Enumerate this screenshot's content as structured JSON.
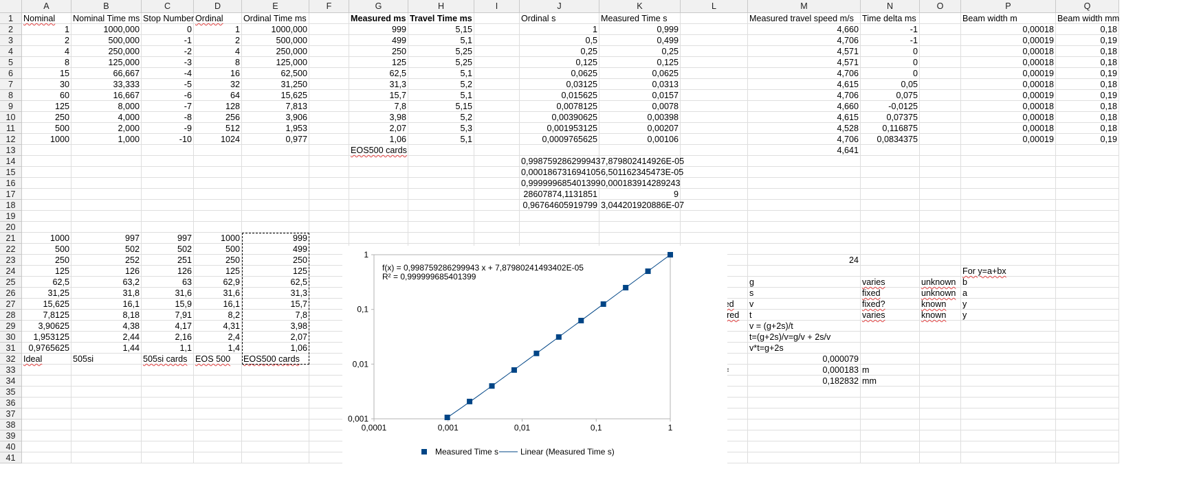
{
  "columns": [
    "A",
    "B",
    "C",
    "D",
    "E",
    "F",
    "G",
    "H",
    "I",
    "J",
    "K",
    "L",
    "M",
    "N",
    "O",
    "P",
    "Q"
  ],
  "rows": 41,
  "cells": [
    {
      "ref": "A1",
      "v": "Nominal",
      "sq": true
    },
    {
      "ref": "B1",
      "v": "Nominal Time ms"
    },
    {
      "ref": "C1",
      "v": "Stop Number"
    },
    {
      "ref": "D1",
      "v": "Ordinal",
      "sq": true
    },
    {
      "ref": "E1",
      "v": "Ordinal Time ms"
    },
    {
      "ref": "G1",
      "v": "Measured ms",
      "b": true
    },
    {
      "ref": "H1",
      "v": "Travel Time ms",
      "b": true
    },
    {
      "ref": "J1",
      "v": "Ordinal s"
    },
    {
      "ref": "K1",
      "v": "Measured Time s"
    },
    {
      "ref": "M1",
      "v": "Measured travel speed m/s"
    },
    {
      "ref": "N1",
      "v": "Time delta ms"
    },
    {
      "ref": "P1",
      "v": "Beam width m"
    },
    {
      "ref": "Q1",
      "v": "Beam width mm"
    },
    {
      "ref": "A2",
      "v": "1",
      "n": true
    },
    {
      "ref": "B2",
      "v": "1000,000",
      "n": true
    },
    {
      "ref": "C2",
      "v": "0",
      "n": true
    },
    {
      "ref": "D2",
      "v": "1",
      "n": true
    },
    {
      "ref": "E2",
      "v": "1000,000",
      "n": true
    },
    {
      "ref": "G2",
      "v": "999",
      "n": true
    },
    {
      "ref": "H2",
      "v": "5,15",
      "n": true
    },
    {
      "ref": "J2",
      "v": "1",
      "n": true
    },
    {
      "ref": "K2",
      "v": "0,999",
      "n": true
    },
    {
      "ref": "M2",
      "v": "4,660",
      "n": true
    },
    {
      "ref": "N2",
      "v": "-1",
      "n": true
    },
    {
      "ref": "P2",
      "v": "0,00018",
      "n": true
    },
    {
      "ref": "Q2",
      "v": "0,18",
      "n": true
    },
    {
      "ref": "A3",
      "v": "2",
      "n": true
    },
    {
      "ref": "B3",
      "v": "500,000",
      "n": true
    },
    {
      "ref": "C3",
      "v": "-1",
      "n": true
    },
    {
      "ref": "D3",
      "v": "2",
      "n": true
    },
    {
      "ref": "E3",
      "v": "500,000",
      "n": true
    },
    {
      "ref": "G3",
      "v": "499",
      "n": true
    },
    {
      "ref": "H3",
      "v": "5,1",
      "n": true
    },
    {
      "ref": "J3",
      "v": "0,5",
      "n": true
    },
    {
      "ref": "K3",
      "v": "0,499",
      "n": true
    },
    {
      "ref": "M3",
      "v": "4,706",
      "n": true
    },
    {
      "ref": "N3",
      "v": "-1",
      "n": true
    },
    {
      "ref": "P3",
      "v": "0,00019",
      "n": true
    },
    {
      "ref": "Q3",
      "v": "0,19",
      "n": true
    },
    {
      "ref": "A4",
      "v": "4",
      "n": true
    },
    {
      "ref": "B4",
      "v": "250,000",
      "n": true
    },
    {
      "ref": "C4",
      "v": "-2",
      "n": true
    },
    {
      "ref": "D4",
      "v": "4",
      "n": true
    },
    {
      "ref": "E4",
      "v": "250,000",
      "n": true
    },
    {
      "ref": "G4",
      "v": "250",
      "n": true
    },
    {
      "ref": "H4",
      "v": "5,25",
      "n": true
    },
    {
      "ref": "J4",
      "v": "0,25",
      "n": true
    },
    {
      "ref": "K4",
      "v": "0,25",
      "n": true
    },
    {
      "ref": "M4",
      "v": "4,571",
      "n": true
    },
    {
      "ref": "N4",
      "v": "0",
      "n": true
    },
    {
      "ref": "P4",
      "v": "0,00018",
      "n": true
    },
    {
      "ref": "Q4",
      "v": "0,18",
      "n": true
    },
    {
      "ref": "A5",
      "v": "8",
      "n": true
    },
    {
      "ref": "B5",
      "v": "125,000",
      "n": true
    },
    {
      "ref": "C5",
      "v": "-3",
      "n": true
    },
    {
      "ref": "D5",
      "v": "8",
      "n": true
    },
    {
      "ref": "E5",
      "v": "125,000",
      "n": true
    },
    {
      "ref": "G5",
      "v": "125",
      "n": true
    },
    {
      "ref": "H5",
      "v": "5,25",
      "n": true
    },
    {
      "ref": "J5",
      "v": "0,125",
      "n": true
    },
    {
      "ref": "K5",
      "v": "0,125",
      "n": true
    },
    {
      "ref": "M5",
      "v": "4,571",
      "n": true
    },
    {
      "ref": "N5",
      "v": "0",
      "n": true
    },
    {
      "ref": "P5",
      "v": "0,00018",
      "n": true
    },
    {
      "ref": "Q5",
      "v": "0,18",
      "n": true
    },
    {
      "ref": "A6",
      "v": "15",
      "n": true
    },
    {
      "ref": "B6",
      "v": "66,667",
      "n": true
    },
    {
      "ref": "C6",
      "v": "-4",
      "n": true
    },
    {
      "ref": "D6",
      "v": "16",
      "n": true
    },
    {
      "ref": "E6",
      "v": "62,500",
      "n": true
    },
    {
      "ref": "G6",
      "v": "62,5",
      "n": true
    },
    {
      "ref": "H6",
      "v": "5,1",
      "n": true
    },
    {
      "ref": "J6",
      "v": "0,0625",
      "n": true
    },
    {
      "ref": "K6",
      "v": "0,0625",
      "n": true
    },
    {
      "ref": "M6",
      "v": "4,706",
      "n": true
    },
    {
      "ref": "N6",
      "v": "0",
      "n": true
    },
    {
      "ref": "P6",
      "v": "0,00019",
      "n": true
    },
    {
      "ref": "Q6",
      "v": "0,19",
      "n": true
    },
    {
      "ref": "A7",
      "v": "30",
      "n": true
    },
    {
      "ref": "B7",
      "v": "33,333",
      "n": true
    },
    {
      "ref": "C7",
      "v": "-5",
      "n": true
    },
    {
      "ref": "D7",
      "v": "32",
      "n": true
    },
    {
      "ref": "E7",
      "v": "31,250",
      "n": true
    },
    {
      "ref": "G7",
      "v": "31,3",
      "n": true
    },
    {
      "ref": "H7",
      "v": "5,2",
      "n": true
    },
    {
      "ref": "J7",
      "v": "0,03125",
      "n": true
    },
    {
      "ref": "K7",
      "v": "0,0313",
      "n": true
    },
    {
      "ref": "M7",
      "v": "4,615",
      "n": true
    },
    {
      "ref": "N7",
      "v": "0,05",
      "n": true
    },
    {
      "ref": "P7",
      "v": "0,00018",
      "n": true
    },
    {
      "ref": "Q7",
      "v": "0,18",
      "n": true
    },
    {
      "ref": "A8",
      "v": "60",
      "n": true
    },
    {
      "ref": "B8",
      "v": "16,667",
      "n": true
    },
    {
      "ref": "C8",
      "v": "-6",
      "n": true
    },
    {
      "ref": "D8",
      "v": "64",
      "n": true
    },
    {
      "ref": "E8",
      "v": "15,625",
      "n": true
    },
    {
      "ref": "G8",
      "v": "15,7",
      "n": true
    },
    {
      "ref": "H8",
      "v": "5,1",
      "n": true
    },
    {
      "ref": "J8",
      "v": "0,015625",
      "n": true
    },
    {
      "ref": "K8",
      "v": "0,0157",
      "n": true
    },
    {
      "ref": "M8",
      "v": "4,706",
      "n": true
    },
    {
      "ref": "N8",
      "v": "0,075",
      "n": true
    },
    {
      "ref": "P8",
      "v": "0,00019",
      "n": true
    },
    {
      "ref": "Q8",
      "v": "0,19",
      "n": true
    },
    {
      "ref": "A9",
      "v": "125",
      "n": true
    },
    {
      "ref": "B9",
      "v": "8,000",
      "n": true
    },
    {
      "ref": "C9",
      "v": "-7",
      "n": true
    },
    {
      "ref": "D9",
      "v": "128",
      "n": true
    },
    {
      "ref": "E9",
      "v": "7,813",
      "n": true
    },
    {
      "ref": "G9",
      "v": "7,8",
      "n": true
    },
    {
      "ref": "H9",
      "v": "5,15",
      "n": true
    },
    {
      "ref": "J9",
      "v": "0,0078125",
      "n": true
    },
    {
      "ref": "K9",
      "v": "0,0078",
      "n": true
    },
    {
      "ref": "M9",
      "v": "4,660",
      "n": true
    },
    {
      "ref": "N9",
      "v": "-0,0125",
      "n": true
    },
    {
      "ref": "P9",
      "v": "0,00018",
      "n": true
    },
    {
      "ref": "Q9",
      "v": "0,18",
      "n": true
    },
    {
      "ref": "A10",
      "v": "250",
      "n": true
    },
    {
      "ref": "B10",
      "v": "4,000",
      "n": true
    },
    {
      "ref": "C10",
      "v": "-8",
      "n": true
    },
    {
      "ref": "D10",
      "v": "256",
      "n": true
    },
    {
      "ref": "E10",
      "v": "3,906",
      "n": true
    },
    {
      "ref": "G10",
      "v": "3,98",
      "n": true
    },
    {
      "ref": "H10",
      "v": "5,2",
      "n": true
    },
    {
      "ref": "J10",
      "v": "0,00390625",
      "n": true
    },
    {
      "ref": "K10",
      "v": "0,00398",
      "n": true
    },
    {
      "ref": "M10",
      "v": "4,615",
      "n": true
    },
    {
      "ref": "N10",
      "v": "0,07375",
      "n": true
    },
    {
      "ref": "P10",
      "v": "0,00018",
      "n": true
    },
    {
      "ref": "Q10",
      "v": "0,18",
      "n": true
    },
    {
      "ref": "A11",
      "v": "500",
      "n": true
    },
    {
      "ref": "B11",
      "v": "2,000",
      "n": true
    },
    {
      "ref": "C11",
      "v": "-9",
      "n": true
    },
    {
      "ref": "D11",
      "v": "512",
      "n": true
    },
    {
      "ref": "E11",
      "v": "1,953",
      "n": true
    },
    {
      "ref": "G11",
      "v": "2,07",
      "n": true
    },
    {
      "ref": "H11",
      "v": "5,3",
      "n": true
    },
    {
      "ref": "J11",
      "v": "0,001953125",
      "n": true
    },
    {
      "ref": "K11",
      "v": "0,00207",
      "n": true
    },
    {
      "ref": "M11",
      "v": "4,528",
      "n": true
    },
    {
      "ref": "N11",
      "v": "0,116875",
      "n": true
    },
    {
      "ref": "P11",
      "v": "0,00018",
      "n": true
    },
    {
      "ref": "Q11",
      "v": "0,18",
      "n": true
    },
    {
      "ref": "A12",
      "v": "1000",
      "n": true
    },
    {
      "ref": "B12",
      "v": "1,000",
      "n": true
    },
    {
      "ref": "C12",
      "v": "-10",
      "n": true
    },
    {
      "ref": "D12",
      "v": "1024",
      "n": true
    },
    {
      "ref": "E12",
      "v": "0,977",
      "n": true
    },
    {
      "ref": "G12",
      "v": "1,06",
      "n": true
    },
    {
      "ref": "H12",
      "v": "5,1",
      "n": true
    },
    {
      "ref": "J12",
      "v": "0,0009765625",
      "n": true
    },
    {
      "ref": "K12",
      "v": "0,00106",
      "n": true
    },
    {
      "ref": "M12",
      "v": "4,706",
      "n": true
    },
    {
      "ref": "N12",
      "v": "0,0834375",
      "n": true
    },
    {
      "ref": "P12",
      "v": "0,00019",
      "n": true
    },
    {
      "ref": "Q12",
      "v": "0,19",
      "n": true
    },
    {
      "ref": "G13",
      "v": "EOS500 cards",
      "sq": true
    },
    {
      "ref": "M13",
      "v": "4,641",
      "n": true
    },
    {
      "ref": "J14",
      "v": "0,998759286299943",
      "n": true
    },
    {
      "ref": "K14",
      "v": "7,879802414926E-05",
      "n": true
    },
    {
      "ref": "J15",
      "v": "0,000186731694105",
      "n": true
    },
    {
      "ref": "K15",
      "v": "6,501162345473E-05",
      "n": true
    },
    {
      "ref": "J16",
      "v": "0,999999685401399",
      "n": true
    },
    {
      "ref": "K16",
      "v": "0,000183914289243",
      "n": true
    },
    {
      "ref": "J17",
      "v": "28607874,1131851",
      "n": true
    },
    {
      "ref": "K17",
      "v": "9",
      "n": true
    },
    {
      "ref": "J18",
      "v": "0,96764605919799",
      "n": true
    },
    {
      "ref": "K18",
      "v": "3,044201920886E-07",
      "n": true
    },
    {
      "ref": "A21",
      "v": "1000",
      "n": true
    },
    {
      "ref": "B21",
      "v": "997",
      "n": true
    },
    {
      "ref": "C21",
      "v": "997",
      "n": true
    },
    {
      "ref": "D21",
      "v": "1000",
      "n": true
    },
    {
      "ref": "E21",
      "v": "999",
      "n": true
    },
    {
      "ref": "A22",
      "v": "500",
      "n": true
    },
    {
      "ref": "B22",
      "v": "502",
      "n": true
    },
    {
      "ref": "C22",
      "v": "502",
      "n": true
    },
    {
      "ref": "D22",
      "v": "500",
      "n": true
    },
    {
      "ref": "E22",
      "v": "499",
      "n": true
    },
    {
      "ref": "A23",
      "v": "250",
      "n": true
    },
    {
      "ref": "B23",
      "v": "252",
      "n": true
    },
    {
      "ref": "C23",
      "v": "251",
      "n": true
    },
    {
      "ref": "D23",
      "v": "250",
      "n": true
    },
    {
      "ref": "E23",
      "v": "250",
      "n": true
    },
    {
      "ref": "A24",
      "v": "125",
      "n": true
    },
    {
      "ref": "B24",
      "v": "126",
      "n": true
    },
    {
      "ref": "C24",
      "v": "126",
      "n": true
    },
    {
      "ref": "D24",
      "v": "125",
      "n": true
    },
    {
      "ref": "E24",
      "v": "125",
      "n": true
    },
    {
      "ref": "A25",
      "v": "62,5",
      "n": true
    },
    {
      "ref": "B25",
      "v": "63,2",
      "n": true
    },
    {
      "ref": "C25",
      "v": "63",
      "n": true
    },
    {
      "ref": "D25",
      "v": "62,9",
      "n": true
    },
    {
      "ref": "E25",
      "v": "62,5",
      "n": true
    },
    {
      "ref": "A26",
      "v": "31,25",
      "n": true
    },
    {
      "ref": "B26",
      "v": "31,8",
      "n": true
    },
    {
      "ref": "C26",
      "v": "31,6",
      "n": true
    },
    {
      "ref": "D26",
      "v": "31,6",
      "n": true
    },
    {
      "ref": "E26",
      "v": "31,3",
      "n": true
    },
    {
      "ref": "A27",
      "v": "15,625",
      "n": true
    },
    {
      "ref": "B27",
      "v": "16,1",
      "n": true
    },
    {
      "ref": "C27",
      "v": "15,9",
      "n": true
    },
    {
      "ref": "D27",
      "v": "16,1",
      "n": true
    },
    {
      "ref": "E27",
      "v": "15,7",
      "n": true
    },
    {
      "ref": "A28",
      "v": "7,8125",
      "n": true
    },
    {
      "ref": "B28",
      "v": "8,18",
      "n": true
    },
    {
      "ref": "C28",
      "v": "7,91",
      "n": true
    },
    {
      "ref": "D28",
      "v": "8,2",
      "n": true
    },
    {
      "ref": "E28",
      "v": "7,8",
      "n": true
    },
    {
      "ref": "A29",
      "v": "3,90625",
      "n": true
    },
    {
      "ref": "B29",
      "v": "4,38",
      "n": true
    },
    {
      "ref": "C29",
      "v": "4,17",
      "n": true
    },
    {
      "ref": "D29",
      "v": "4,31",
      "n": true
    },
    {
      "ref": "E29",
      "v": "3,98",
      "n": true
    },
    {
      "ref": "A30",
      "v": "1,953125",
      "n": true
    },
    {
      "ref": "B30",
      "v": "2,44",
      "n": true
    },
    {
      "ref": "C30",
      "v": "2,16",
      "n": true
    },
    {
      "ref": "D30",
      "v": "2,4",
      "n": true
    },
    {
      "ref": "E30",
      "v": "2,07",
      "n": true
    },
    {
      "ref": "A31",
      "v": "0,9765625",
      "n": true
    },
    {
      "ref": "B31",
      "v": "1,44",
      "n": true
    },
    {
      "ref": "C31",
      "v": "1,1",
      "n": true
    },
    {
      "ref": "D31",
      "v": "1,4",
      "n": true
    },
    {
      "ref": "E31",
      "v": "1,06",
      "n": true
    },
    {
      "ref": "A32",
      "v": "Ideal",
      "sq": true
    },
    {
      "ref": "B32",
      "v": "505si"
    },
    {
      "ref": "C32",
      "v": "505si cards",
      "sq": true
    },
    {
      "ref": "D32",
      "v": "EOS 500",
      "sq": true
    },
    {
      "ref": "E32",
      "v": "EOS500 cards",
      "sq": true
    },
    {
      "ref": "L23",
      "v": "Travel mm"
    },
    {
      "ref": "M23",
      "v": "24",
      "n": true
    },
    {
      "ref": "P24",
      "v": "For y=a+bx",
      "sq": true
    },
    {
      "ref": "L25",
      "v": "gap width"
    },
    {
      "ref": "M25",
      "v": "g"
    },
    {
      "ref": "N25",
      "v": "varies",
      "sq": true
    },
    {
      "ref": "O25",
      "v": "unknown",
      "sq": true
    },
    {
      "ref": "P25",
      "v": "b"
    },
    {
      "ref": "L26",
      "v": "Beam width",
      "sq": true
    },
    {
      "ref": "M26",
      "v": "s"
    },
    {
      "ref": "N26",
      "v": "fixed",
      "sq": true
    },
    {
      "ref": "O26",
      "v": "unknown",
      "sq": true
    },
    {
      "ref": "P26",
      "v": "a"
    },
    {
      "ref": "L27",
      "v": "curtain speed",
      "sq": true
    },
    {
      "ref": "M27",
      "v": "v"
    },
    {
      "ref": "N27",
      "v": "fixed?",
      "sq": true
    },
    {
      "ref": "O27",
      "v": "known",
      "sq": true
    },
    {
      "ref": "P27",
      "v": "y"
    },
    {
      "ref": "L28",
      "v": "time measured",
      "sq": true
    },
    {
      "ref": "M28",
      "v": "t"
    },
    {
      "ref": "N28",
      "v": "varies",
      "sq": true
    },
    {
      "ref": "O28",
      "v": "known",
      "sq": true
    },
    {
      "ref": "P28",
      "v": "y"
    },
    {
      "ref": "M29",
      "v": "v = (g+2s)/t"
    },
    {
      "ref": "M30",
      "v": "t=(g+2s)/v=g/v + 2s/v"
    },
    {
      "ref": "M31",
      "v": "v*t=g+2s"
    },
    {
      "ref": "L32",
      "v": "2s/v = a ="
    },
    {
      "ref": "M32",
      "v": "0,000079",
      "n": true
    },
    {
      "ref": "L33",
      "v": "s = (a*v)/2 ="
    },
    {
      "ref": "M33",
      "v": "0,000183",
      "n": true
    },
    {
      "ref": "N33",
      "v": "m"
    },
    {
      "ref": "M34",
      "v": "0,182832",
      "n": true
    },
    {
      "ref": "N34",
      "v": "mm"
    }
  ],
  "selection_range": "E21:E32",
  "chart_data": {
    "type": "scatter",
    "x_scale": "log",
    "y_scale": "log",
    "xlim": [
      0.0001,
      1
    ],
    "ylim": [
      0.001,
      1
    ],
    "x_ticks": [
      "0,0001",
      "0,001",
      "0,01",
      "0,1",
      "1"
    ],
    "y_ticks": [
      "0,001",
      "0,01",
      "0,1",
      "1"
    ],
    "series": [
      {
        "name": "Measured Time s",
        "marker": "square",
        "color": "#004586",
        "x": [
          1,
          0.5,
          0.25,
          0.125,
          0.0625,
          0.03125,
          0.015625,
          0.0078125,
          0.00390625,
          0.001953125,
          0.0009765625
        ],
        "y": [
          0.999,
          0.499,
          0.25,
          0.125,
          0.0625,
          0.0313,
          0.0157,
          0.0078,
          0.00398,
          0.00207,
          0.00106
        ]
      },
      {
        "name": "Linear (Measured Time s)",
        "type": "trendline",
        "color": "#004586",
        "slope": 0.998759286299943,
        "intercept": 7.87980241493402e-05
      }
    ],
    "equation_text": "f(x) = 0,998759286299943 x + 7,87980241493402E-05",
    "r2_text": "R² = 0,999999685401399",
    "legend": "bottom"
  }
}
